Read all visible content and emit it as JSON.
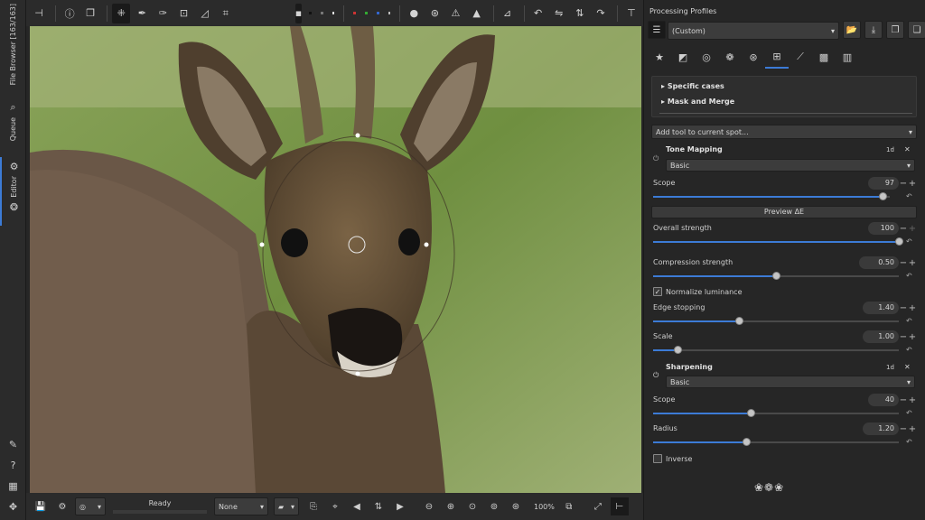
{
  "left_tabs": {
    "file_browser": "File Browser [163/163]",
    "queue": "Queue",
    "editor": "Editor"
  },
  "status": {
    "ready": "Ready",
    "zoom": "100%"
  },
  "bottom": {
    "none_select": "None"
  },
  "panel": {
    "title": "Processing Profiles",
    "profile_value": "(Custom)",
    "spot_list": {
      "specific_cases": "Specific cases",
      "mask_and_merge": "Mask and Merge"
    },
    "add_tool": "Add tool to current spot...",
    "tone_mapping": {
      "title": "Tone Mapping",
      "badge": "1d",
      "mode": "Basic",
      "scope_label": "Scope",
      "scope_value": "97",
      "scope_fraction": 0.97,
      "preview_btn": "Preview ΔE",
      "overall_label": "Overall strength",
      "overall_value": "100",
      "overall_fraction": 1.0,
      "compression_label": "Compression strength",
      "compression_value": "0.50",
      "compression_fraction": 0.5,
      "normalize_label": "Normalize luminance",
      "normalize_checked": true,
      "edge_label": "Edge stopping",
      "edge_value": "1.40",
      "edge_fraction": 0.35,
      "scale_label": "Scale",
      "scale_value": "1.00",
      "scale_fraction": 0.1
    },
    "sharpening": {
      "title": "Sharpening",
      "badge": "1d",
      "mode": "Basic",
      "scope_label": "Scope",
      "scope_value": "40",
      "scope_fraction": 0.4,
      "radius_label": "Radius",
      "radius_value": "1.20",
      "radius_fraction": 0.38,
      "inverse_label": "Inverse",
      "inverse_checked": false
    }
  },
  "colors": {
    "accent": "#3c7bd6",
    "panel_bg": "#262626",
    "toolbar_bg": "#2b2b2b"
  },
  "icons": {
    "left_bottom": [
      "plus-sparkle-icon",
      "help-icon",
      "grid-icon",
      "move-icon"
    ]
  }
}
